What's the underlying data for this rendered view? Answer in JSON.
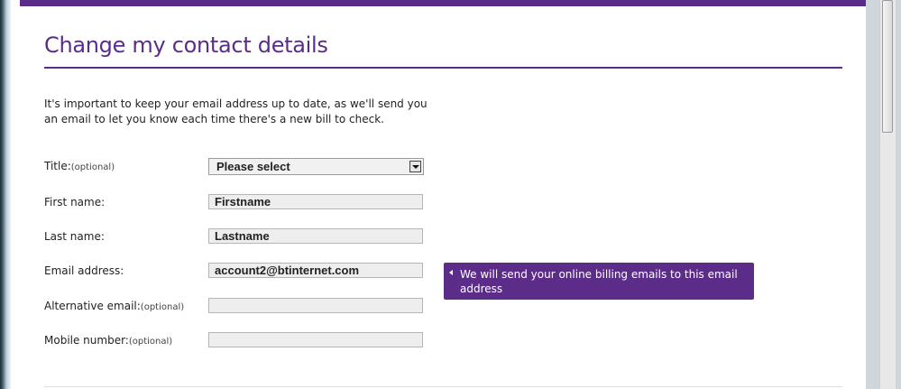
{
  "page": {
    "heading": "Change my contact details",
    "intro": "It's important to keep your email address up to date, as we'll send you an email to let you know each time there's a new bill to check."
  },
  "form": {
    "title": {
      "label": "Title:",
      "optional": "(optional)",
      "value": "Please select"
    },
    "first_name": {
      "label": "First name:",
      "value": "Firstname"
    },
    "last_name": {
      "label": "Last name:",
      "value": "Lastname"
    },
    "email": {
      "label": "Email address:",
      "value": "account2@btinternet.com"
    },
    "alt_email": {
      "label": "Alternative email:",
      "optional": "(optional)",
      "value": ""
    },
    "mobile": {
      "label": "Mobile number:",
      "optional": "(optional)",
      "value": ""
    }
  },
  "tooltip": {
    "text": "We will send your online billing emails to this email address"
  },
  "colors": {
    "brand_purple": "#5b2d89",
    "field_bg": "#eeeeee"
  }
}
